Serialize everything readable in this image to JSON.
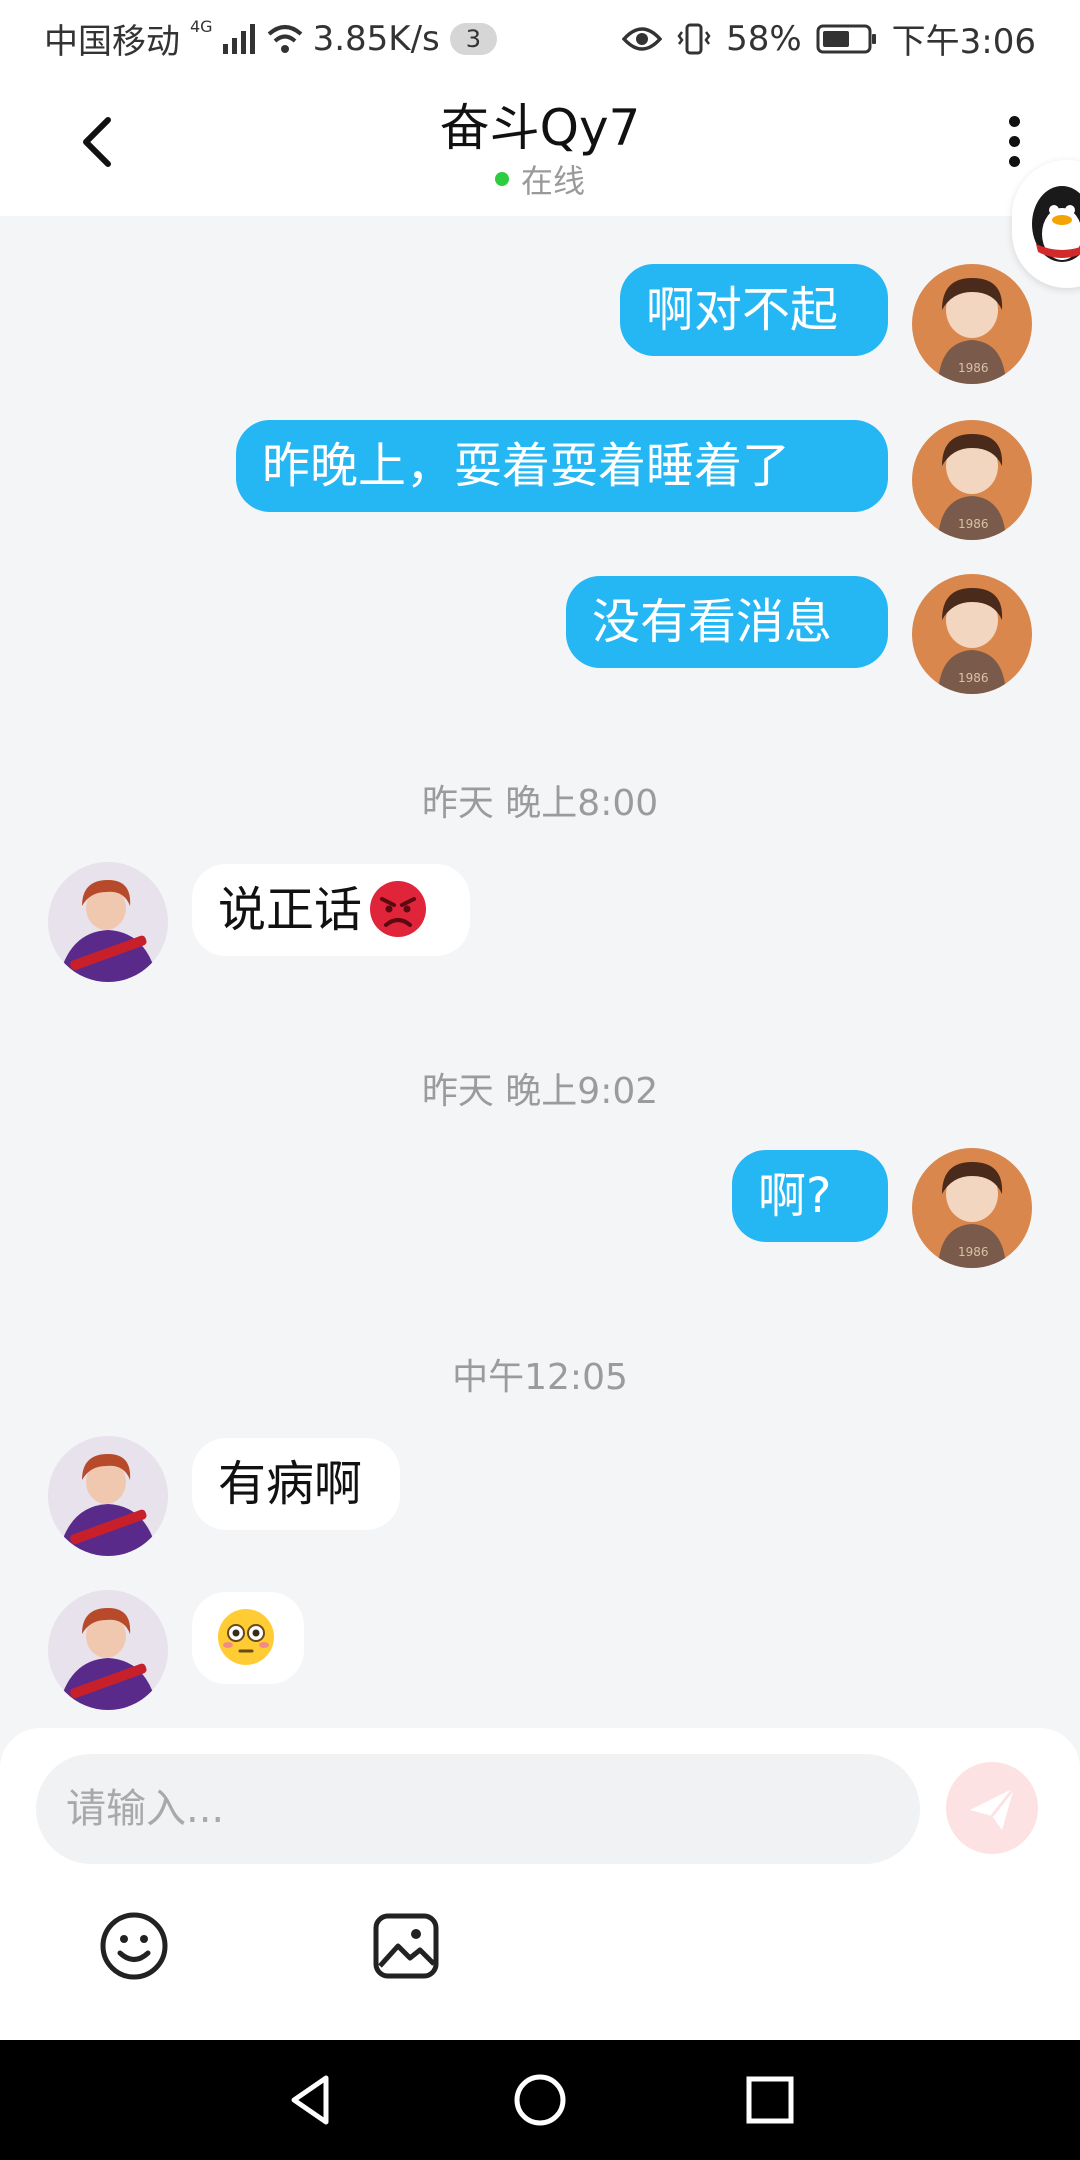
{
  "status_bar": {
    "carrier": "中国移动",
    "network": "4G",
    "speed": "3.85K/s",
    "notification_count": "3",
    "battery": "58%",
    "time": "下午3:06"
  },
  "header": {
    "title": "奋斗Qy7",
    "status": "在线"
  },
  "chat": {
    "messages_block_1": [
      {
        "from": "me",
        "text": "啊对不起"
      },
      {
        "from": "me",
        "text": "昨晚上，耍着耍着睡着了"
      },
      {
        "from": "me",
        "text": "没有看消息"
      }
    ],
    "time_1": "昨天 晚上8:00",
    "msg_angry": {
      "from": "them",
      "text": "说正话",
      "emoji": "angry-face"
    },
    "time_2": "昨天 晚上9:02",
    "msg_ah": {
      "from": "me",
      "text": "啊?"
    },
    "time_3": "中午12:05",
    "msg_sick": {
      "from": "them",
      "text": "有病啊"
    },
    "msg_flushed": {
      "from": "them",
      "emoji": "flushed-face"
    }
  },
  "input": {
    "placeholder": "请输入..."
  },
  "icons": {
    "accent": "#25b6f4",
    "send_color": "#fde2e4"
  }
}
